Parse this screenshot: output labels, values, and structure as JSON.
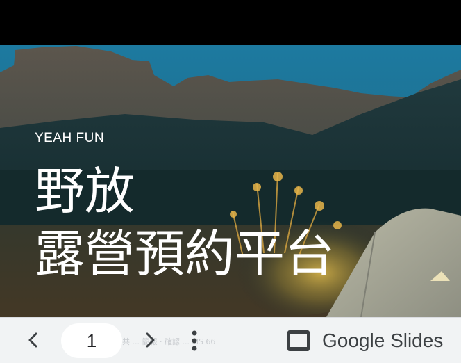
{
  "slide": {
    "kicker": "YEAH FUN",
    "title_line1": "野放",
    "title_line2": "露營預約平台"
  },
  "toolbar": {
    "page_number": "1",
    "ghost_caption": "共 ... 簡報 · 確認 ... MS 66",
    "prev_icon": "chevron-left-icon",
    "next_icon": "chevron-right-icon",
    "more_icon": "more-vert-icon",
    "brand_icon": "slides-icon",
    "brand_label": "Google Slides"
  },
  "colors": {
    "top_bar": "#000000",
    "toolbar_bg": "#f1f3f4",
    "icon": "#3c4043",
    "sky": "#1f6f8e",
    "title_text": "#ffffff"
  }
}
